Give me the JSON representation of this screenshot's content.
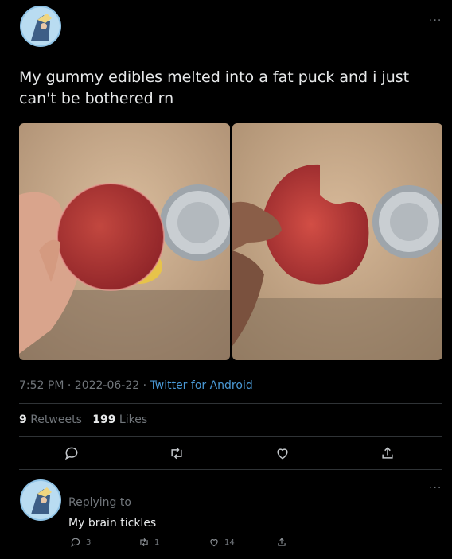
{
  "tweet": {
    "text": "My gummy edibles melted into a fat puck and i just can't be bothered rn",
    "time": "7:52 PM",
    "date": "2022-06-22",
    "separator": "·",
    "source": "Twitter for Android",
    "retweets_count": "9",
    "retweets_label": "Retweets",
    "likes_count": "199",
    "likes_label": "Likes",
    "more": "..."
  },
  "actions": {
    "reply_icon": "reply-icon",
    "retweet_icon": "retweet-icon",
    "like_icon": "heart-icon",
    "share_icon": "share-icon"
  },
  "reply": {
    "replying_to": "Replying to",
    "text": "My brain tickles",
    "reply_count": "3",
    "retweet_count": "1",
    "like_count": "14",
    "more": "..."
  },
  "colors": {
    "background": "#000000",
    "text": "#e7e9ea",
    "muted": "#71767b",
    "link": "#4a99d6",
    "divider": "#2f3336"
  }
}
